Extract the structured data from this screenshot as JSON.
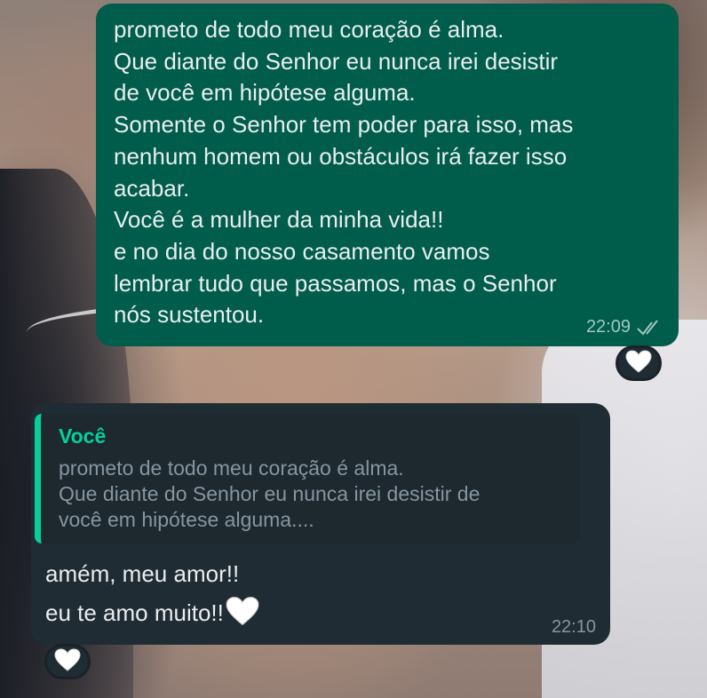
{
  "chat": {
    "outgoing": {
      "lines": [
        "prometo de todo meu coração é alma.",
        "Que diante do Senhor eu nunca irei desistir",
        "de você em hipótese alguma.",
        "Somente o Senhor tem poder para isso, mas",
        "nenhum homem ou obstáculos irá fazer isso",
        "acabar.",
        "Você é a mulher da minha vida!!",
        "e no dia do nosso casamento vamos",
        "lembrar tudo que  passamos, mas o Senhor",
        "nós sustentou."
      ],
      "time": "22:09",
      "status_icon": "double-check-icon",
      "reaction": "white-heart-icon"
    },
    "incoming": {
      "quote": {
        "author": "Você",
        "lines": [
          "prometo de todo meu coração é alma.",
          "Que diante do Senhor eu nunca irei desistir de",
          "você em hipótese alguma...."
        ]
      },
      "lines": [
        "amém, meu amor!!",
        "eu te amo muito!!"
      ],
      "inline_emoji": "white-heart-icon",
      "time": "22:10",
      "reaction": "white-heart-icon"
    }
  },
  "colors": {
    "outgoing_bubble": "#005c4b",
    "incoming_bubble": "#202c33",
    "quote_accent": "#06cf9c",
    "text": "#e9edef",
    "muted": "#8696a0"
  }
}
